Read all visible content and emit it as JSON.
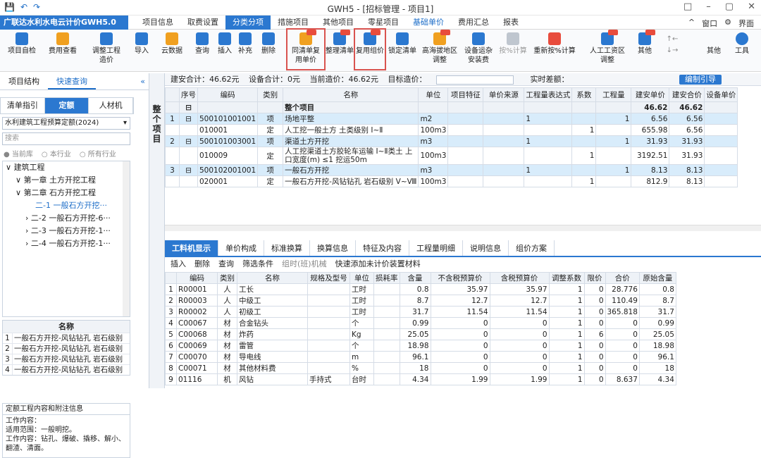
{
  "window": {
    "title": "GWH5 - [招标管理 - 项目1]"
  },
  "menubar": {
    "app_name": "广联达水利水电云计价GWH5.0",
    "menus": [
      "项目信息",
      "取费设置",
      "分类分项",
      "措施项目",
      "其他项目",
      "零星项目",
      "基础单价",
      "费用汇总",
      "报表"
    ],
    "right": [
      "窗口",
      "界面"
    ]
  },
  "toolbar": {
    "items": [
      "项目自检",
      "费用查看",
      "调整工程",
      "造价",
      "导入",
      "云数据",
      "查询",
      "插入",
      "补充",
      "删除",
      "同清单复",
      "用单价",
      "整理清单",
      "复用组价",
      "锁定清单",
      "高海拔地区",
      "调整",
      "设备运杂",
      "安装费",
      "按%计算",
      "重新按%计算",
      "人工工资区",
      "调整",
      "其他",
      "工具"
    ]
  },
  "left": {
    "tabs": [
      "项目结构",
      "快速查询"
    ],
    "subtabs": [
      "清单指引",
      "定额",
      "人材机"
    ],
    "quota_lib": "水利建筑工程预算定额(2024)",
    "search_placeholder": "搜索",
    "radios": [
      "当前库",
      "本行业",
      "所有行业"
    ],
    "tree": [
      {
        "label": "建筑工程",
        "indent": 0,
        "cur": false
      },
      {
        "label": "第一章 土方开挖工程",
        "indent": 1,
        "cur": false
      },
      {
        "label": "第二章 石方开挖工程",
        "indent": 1,
        "cur": false
      },
      {
        "label": "二-1 一般石方开挖···",
        "indent": 3,
        "cur": true
      },
      {
        "label": "二-2 一般石方开挖-6···",
        "indent": 2,
        "cur": false
      },
      {
        "label": "二-3 一般石方开挖-1···",
        "indent": 2,
        "cur": false
      },
      {
        "label": "二-4 一般石方开挖-1···",
        "indent": 2,
        "cur": false
      }
    ],
    "mini_header": "名称",
    "mini_rows": [
      "一般石方开挖-风钻钻孔 岩石级别",
      "一般石方开挖-风钻钻孔 岩石级别",
      "一般石方开挖-风钻钻孔 岩石级别",
      "一般石方开挖-风钻钻孔 岩石级别"
    ],
    "note_title": "定额工程内容和附注信息",
    "note_body": "工作内容：\n适用范围：一般明挖。\n工作内容：钻孔、爆破、撬移、解小、翻渣、清面。"
  },
  "side_label": "整个项目",
  "summary": {
    "build_install": "建安合计：46.62元",
    "equip": "设备合计：0元",
    "current_cost": "当前造价：46.62元",
    "target": "目标造价：",
    "actual_diff": "实时差额：",
    "btn": "编制引导"
  },
  "grid_headers": [
    "序号",
    "编码",
    "类别",
    "名称",
    "单位",
    "项目特征",
    "单价来源",
    "工程量表达式",
    "系数",
    "工程量",
    "建安单价",
    "建安合价",
    "设备单价"
  ],
  "grid_rows": [
    {
      "type": "tot",
      "idx": "",
      "code": "",
      "cat": "",
      "name": "整个项目",
      "unit": "",
      "qexp": "",
      "coef": "",
      "qty": "",
      "price": "46.62",
      "total": "46.62"
    },
    {
      "type": "q",
      "idx": "1",
      "code": "500101001001",
      "cat": "项",
      "name": "场地平整",
      "unit": "m2",
      "qexp": "1",
      "coef": "",
      "qty": "1",
      "price": "6.56",
      "total": "6.56"
    },
    {
      "type": "d",
      "idx": "",
      "code": "010001",
      "cat": "定",
      "name": "人工挖一般土方 土类级别 Ⅰ~Ⅱ",
      "unit": "100m3",
      "qexp": "",
      "coef": "1",
      "qty": "",
      "price": "655.98",
      "total": "6.56"
    },
    {
      "type": "q",
      "idx": "2",
      "code": "500101003001",
      "cat": "项",
      "name": "渠道土方开挖",
      "unit": "m3",
      "qexp": "1",
      "coef": "",
      "qty": "1",
      "price": "31.93",
      "total": "31.93"
    },
    {
      "type": "d",
      "idx": "",
      "code": "010009",
      "cat": "定",
      "name": "人工挖渠道土方胶轮车运输 Ⅰ~Ⅱ类土 上口宽度(m) ≤1 挖运50m",
      "unit": "100m3",
      "qexp": "",
      "coef": "1",
      "qty": "",
      "price": "3192.51",
      "total": "31.93"
    },
    {
      "type": "q",
      "idx": "3",
      "code": "500102001001",
      "cat": "项",
      "name": "一般石方开挖",
      "unit": "m3",
      "qexp": "1",
      "coef": "",
      "qty": "1",
      "price": "8.13",
      "total": "8.13"
    },
    {
      "type": "d",
      "idx": "",
      "code": "020001",
      "cat": "定",
      "name": "一般石方开挖-风钻钻孔 岩石级别 Ⅴ~Ⅷ",
      "unit": "100m3",
      "qexp": "",
      "coef": "1",
      "qty": "",
      "price": "812.9",
      "total": "8.13"
    }
  ],
  "bottom_tabs": [
    "工料机显示",
    "单价构成",
    "标准换算",
    "换算信息",
    "特征及内容",
    "工程量明细",
    "说明信息",
    "组价方案"
  ],
  "bottom_actions": [
    "插入",
    "删除",
    "查询",
    "筛选条件",
    "组时(班)机械",
    "快速添加未计价装置材料"
  ],
  "material_headers": [
    "",
    "编码",
    "类别",
    "名称",
    "规格及型号",
    "单位",
    "损耗率",
    "含量",
    "不含税预算价",
    "含税预算价",
    "调整系数",
    "限价",
    "合价",
    "原始含量"
  ],
  "materials": [
    [
      "1",
      "R00001",
      "人",
      "工长",
      "",
      "工时",
      "",
      "0.8",
      "35.97",
      "35.97",
      "1",
      "0",
      "28.776",
      "0.8"
    ],
    [
      "2",
      "R00003",
      "人",
      "中级工",
      "",
      "工时",
      "",
      "8.7",
      "12.7",
      "12.7",
      "1",
      "0",
      "110.49",
      "8.7"
    ],
    [
      "3",
      "R00002",
      "人",
      "初级工",
      "",
      "工时",
      "",
      "31.7",
      "11.54",
      "11.54",
      "1",
      "0",
      "365.818",
      "31.7"
    ],
    [
      "4",
      "C00067",
      "材",
      "合金钻头",
      "",
      "个",
      "",
      "0.99",
      "0",
      "0",
      "1",
      "0",
      "0",
      "0.99"
    ],
    [
      "5",
      "C00068",
      "材",
      "炸药",
      "",
      "Kg",
      "",
      "25.05",
      "0",
      "0",
      "1",
      "6",
      "0",
      "25.05"
    ],
    [
      "6",
      "C00069",
      "材",
      "雷管",
      "",
      "个",
      "",
      "18.98",
      "0",
      "0",
      "1",
      "0",
      "0",
      "18.98"
    ],
    [
      "7",
      "C00070",
      "材",
      "导电线",
      "",
      "m",
      "",
      "96.1",
      "0",
      "0",
      "1",
      "0",
      "0",
      "96.1"
    ],
    [
      "8",
      "C00071",
      "材",
      "其他材料费",
      "",
      "%",
      "",
      "18",
      "0",
      "0",
      "1",
      "0",
      "0",
      "18"
    ],
    [
      "9",
      "01116",
      "机",
      "风钻",
      "手持式",
      "台时",
      "",
      "4.34",
      "1.99",
      "1.99",
      "1",
      "0",
      "8.637",
      "4.34"
    ]
  ],
  "colors": {
    "accent": "#2b78d0",
    "highlight": "#d9534f"
  }
}
